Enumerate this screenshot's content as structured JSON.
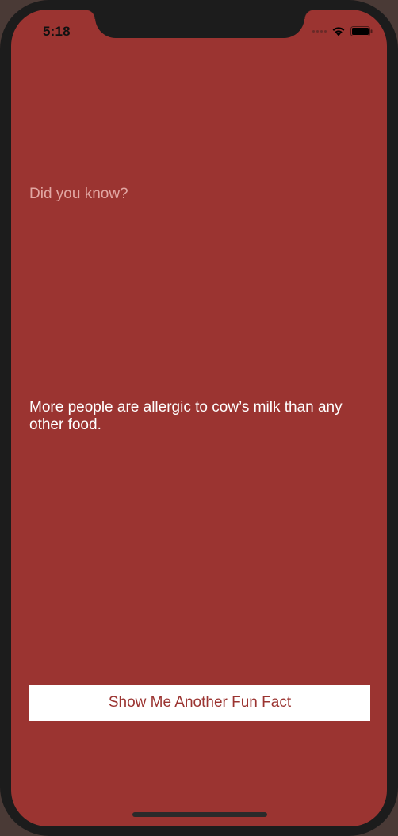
{
  "status_bar": {
    "time": "5:18"
  },
  "main": {
    "heading": "Did you know?",
    "fact": "More people are allergic to cow’s milk than any other food.",
    "button_label": "Show Me Another Fun Fact"
  },
  "colors": {
    "background": "#9b3431",
    "heading_text": "#e2a7a3",
    "fact_text": "#ffffff",
    "button_background": "#ffffff",
    "button_text": "#9b3431"
  },
  "icons": {
    "signal": "signal-dots-icon",
    "wifi": "wifi-icon",
    "battery": "battery-icon"
  }
}
